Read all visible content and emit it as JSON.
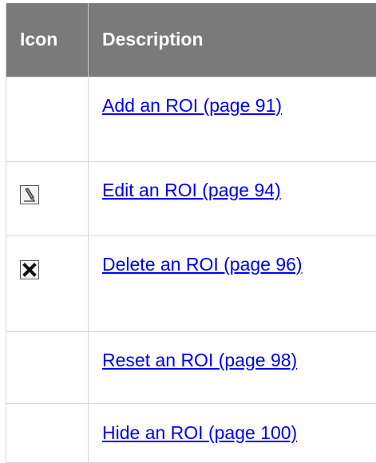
{
  "table": {
    "headers": {
      "icon": "Icon",
      "description": "Description"
    },
    "rows": [
      {
        "icon": null,
        "link": "Add an ROI (page 91)"
      },
      {
        "icon": "pencil-edit-icon",
        "link": "Edit an ROI (page 94)"
      },
      {
        "icon": "delete-x-icon",
        "link": "Delete an ROI (page 96)"
      },
      {
        "icon": null,
        "link": "Reset an ROI (page 98)"
      },
      {
        "icon": null,
        "link": "Hide an ROI (page 100)"
      }
    ]
  },
  "colors": {
    "header_bg": "#7a7a7a",
    "header_text": "#ffffff",
    "link": "#0000ee",
    "border": "#d6d6d6"
  }
}
